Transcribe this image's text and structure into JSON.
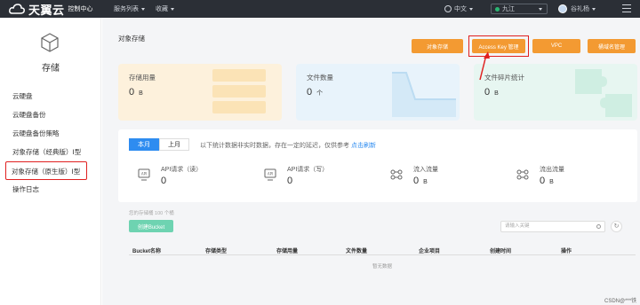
{
  "topbar": {
    "brand": "天翼云",
    "brand_sub": "控制中心",
    "nav": [
      "服务列表",
      "收藏"
    ],
    "lang": "中文",
    "region": "九江",
    "username": "谷礼杨"
  },
  "sidebar": {
    "title": "存储",
    "items": [
      {
        "label": "云硬盘"
      },
      {
        "label": "云硬盘备份"
      },
      {
        "label": "云硬盘备份策略"
      },
      {
        "label": "对象存储（经典版）Ⅰ型"
      },
      {
        "label": "对象存储（原生版）Ⅰ型"
      },
      {
        "label": "操作日志"
      }
    ]
  },
  "main": {
    "title": "对象存储",
    "buttons": [
      "对象存储",
      "Access Key 管理",
      "VPC",
      "桶域名管理"
    ],
    "cards": [
      {
        "label": "存储用量",
        "value": "0",
        "unit": "B"
      },
      {
        "label": "文件数量",
        "value": "0",
        "unit": "个"
      },
      {
        "label": "文件碎片统计",
        "value": "0",
        "unit": "B"
      }
    ],
    "tabs": [
      "本月",
      "上月"
    ],
    "tip": "以下统计数据非实时数据，存在一定的延迟，仅供参考",
    "tip_link": "点击刷新",
    "metrics": [
      {
        "label": "API请求（读）",
        "value": "0",
        "unit": ""
      },
      {
        "label": "API请求（写）",
        "value": "0",
        "unit": ""
      },
      {
        "label": "流入流量",
        "value": "0",
        "unit": "B"
      },
      {
        "label": "流出流量",
        "value": "0",
        "unit": "B"
      }
    ],
    "bucket_note": "您的存储桶 100 个桶",
    "create_button": "创建Bucket",
    "search_placeholder": "请输入关键",
    "columns": [
      "Bucket名称",
      "存储类型",
      "存储用量",
      "文件数量",
      "企业项目",
      "创建时间",
      "操作"
    ],
    "empty_text": "暂无数据"
  },
  "watermark": "CSDN@***铁"
}
